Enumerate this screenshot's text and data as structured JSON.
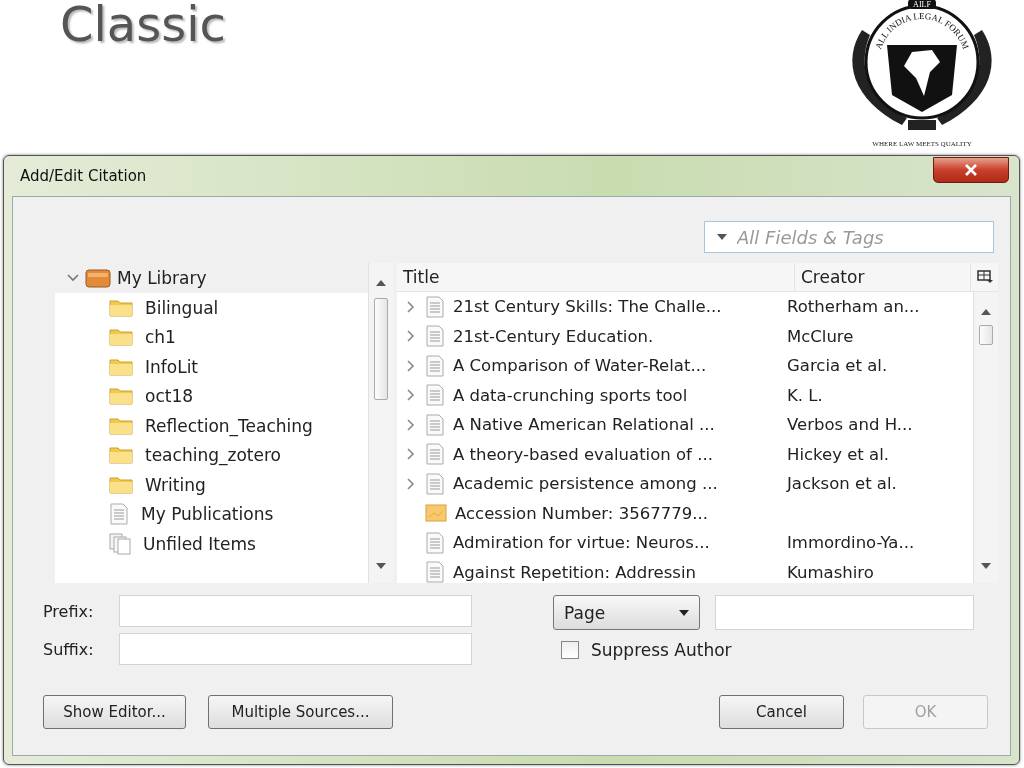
{
  "slide": {
    "title": "Classic",
    "logo": {
      "badge": "AILF",
      "arc_text": "ALL INDIA LEGAL FORUM",
      "motto": "WHERE LAW MEETS QUALITY"
    }
  },
  "dialog": {
    "title": "Add/Edit Citation",
    "search": {
      "placeholder": "All Fields & Tags"
    },
    "library": {
      "label": "My Library",
      "expanded": true,
      "children": [
        {
          "label": "Bilingual",
          "kind": "folder"
        },
        {
          "label": "ch1",
          "kind": "folder"
        },
        {
          "label": "InfoLit",
          "kind": "folder"
        },
        {
          "label": "oct18",
          "kind": "folder"
        },
        {
          "label": "Reflection_Teaching",
          "kind": "folder"
        },
        {
          "label": "teaching_zotero",
          "kind": "folder"
        },
        {
          "label": "Writing",
          "kind": "folder"
        },
        {
          "label": "My Publications",
          "kind": "publications"
        },
        {
          "label": "Unfiled Items",
          "kind": "unfiled"
        }
      ]
    },
    "table": {
      "columns": [
        "Title",
        "Creator"
      ],
      "rows": [
        {
          "title": "21st Century Skills: The Challe...",
          "creator": "Rotherham an...",
          "kind": "document",
          "expandable": true
        },
        {
          "title": "21st-Century Education.",
          "creator": "McClure",
          "kind": "document",
          "expandable": true
        },
        {
          "title": "A Comparison of Water-Relat...",
          "creator": "Garcia et al.",
          "kind": "document",
          "expandable": true
        },
        {
          "title": "A data-crunching sports tool",
          "creator": "K. L.",
          "kind": "document",
          "expandable": true
        },
        {
          "title": "A Native American Relational ...",
          "creator": "Verbos and H...",
          "kind": "document",
          "expandable": true
        },
        {
          "title": "A theory-based evaluation of ...",
          "creator": "Hickey et al.",
          "kind": "document",
          "expandable": true
        },
        {
          "title": "Academic persistence among ...",
          "creator": "Jackson et al.",
          "kind": "document",
          "expandable": true
        },
        {
          "title": "Accession Number: 3567779...",
          "kind": "attachment",
          "expandable": false
        },
        {
          "title": "Admiration for virtue: Neuros...",
          "creator": "Immordino-Ya...",
          "kind": "document",
          "expandable": false
        },
        {
          "title": "Against Repetition: Addressin",
          "creator": "Kumashiro",
          "kind": "document",
          "expandable": false
        }
      ]
    },
    "prefix": {
      "label": "Prefix:"
    },
    "suffix": {
      "label": "Suffix:"
    },
    "locator": {
      "value": "Page"
    },
    "suppress_author": {
      "label": "Suppress Author",
      "checked": false
    },
    "left_buttons": [
      {
        "label": "Show Editor...",
        "disabled": false
      },
      {
        "label": "Multiple Sources...",
        "disabled": false
      }
    ],
    "right_buttons": [
      {
        "label": "Cancel",
        "disabled": false
      },
      {
        "label": "OK",
        "disabled": true
      }
    ]
  }
}
